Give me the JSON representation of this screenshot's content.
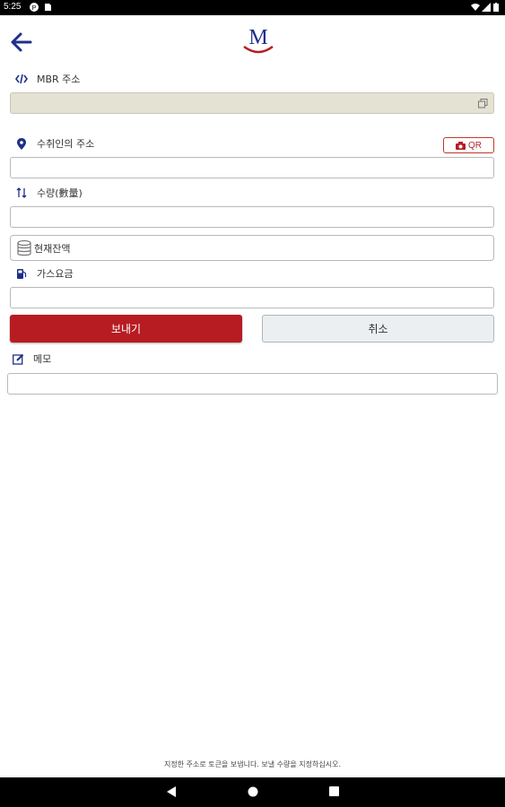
{
  "status_bar": {
    "time": "5:25"
  },
  "header": {
    "logo_letter": "M"
  },
  "fields": {
    "mbr_address": {
      "label": "MBR 주소",
      "value": ""
    },
    "recipient_address": {
      "label": "수취인의 주소",
      "value": "",
      "qr_label": "QR"
    },
    "quantity": {
      "label": "수량(數量)",
      "value": ""
    },
    "balance": {
      "label": "현재잔액"
    },
    "gas_fee": {
      "label": "가스요금",
      "value": ""
    }
  },
  "buttons": {
    "send": "보내기",
    "cancel": "취소"
  },
  "memo": {
    "label": "메모",
    "value": ""
  },
  "footer": {
    "note": "지정한 주소로 토큰을 보냅니다. 보낼 수량을 지정하십시오."
  },
  "colors": {
    "accent": "#b71c23",
    "navy": "#1f2f8a",
    "readonly_bg": "#e4e2d3"
  },
  "icons": [
    "back-arrow-icon",
    "code-icon",
    "copy-icon",
    "location-pin-icon",
    "camera-icon",
    "swap-vertical-icon",
    "database-icon",
    "gas-pump-icon",
    "edit-icon"
  ]
}
